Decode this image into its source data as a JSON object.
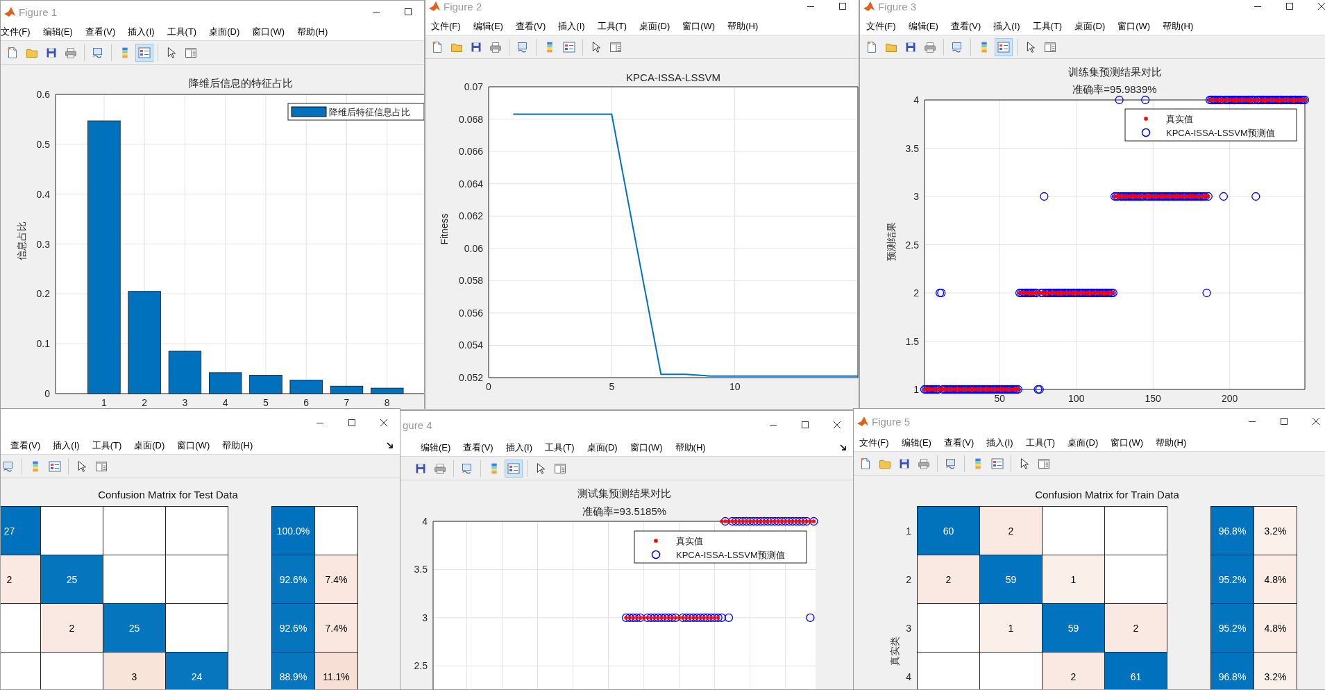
{
  "windows": [
    {
      "title": "Figure 1",
      "kind": "chart",
      "menu": [
        "文件(F)",
        "编辑(E)",
        "查看(V)",
        "插入(I)",
        "工具(T)",
        "桌面(D)",
        "窗口(W)",
        "帮助(H)"
      ],
      "legend_tool_on": true,
      "chart_data": {
        "type": "bar",
        "title": "降维后信息的特征占比",
        "ylabel": "信息占比",
        "categories": [
          "1",
          "2",
          "3",
          "4",
          "5",
          "6",
          "7",
          "8"
        ],
        "ylim": [
          0,
          0.6
        ],
        "yticks": [
          0,
          0.1,
          0.2,
          0.3,
          0.4,
          0.5,
          0.6
        ],
        "grid": true,
        "legend": true,
        "series": [
          {
            "name": "降维后特征信息占比",
            "color": "#0072bd",
            "values": [
              0.547,
              0.205,
              0.085,
              0.042,
              0.037,
              0.027,
              0.015,
              0.011
            ]
          }
        ]
      }
    },
    {
      "title": "Figure 2",
      "kind": "chart",
      "menu": [
        "文件(F)",
        "编辑(E)",
        "查看(V)",
        "插入(I)",
        "工具(T)",
        "桌面(D)",
        "窗口(W)",
        "帮助(H)"
      ],
      "legend_tool_on": false,
      "chart_data": {
        "type": "line",
        "title": "KPCA-ISSA-LSSVM",
        "ylabel": "Fitness",
        "x": [
          1,
          2,
          3,
          4,
          5,
          6,
          7,
          8,
          9,
          10,
          11,
          12,
          13,
          14,
          15
        ],
        "xlim": [
          0,
          15
        ],
        "ylim": [
          0.052,
          0.07
        ],
        "xticks": [
          0,
          5,
          10
        ],
        "yticks": [
          0.052,
          0.054,
          0.056,
          0.058,
          0.06,
          0.062,
          0.064,
          0.066,
          0.068,
          0.07
        ],
        "grid": true,
        "series": [
          {
            "color": "#0072bd",
            "values": [
              0.0683,
              0.0683,
              0.0683,
              0.0683,
              0.0683,
              0.0602,
              0.0522,
              0.0522,
              0.0521,
              0.0521,
              0.0521,
              0.0521,
              0.0521,
              0.0521,
              0.0521
            ]
          }
        ]
      }
    },
    {
      "title": "Figure 3",
      "kind": "chart",
      "menu": [
        "文件(F)",
        "编辑(E)",
        "查看(V)",
        "插入(I)",
        "工具(T)",
        "桌面(D)",
        "窗口(W)",
        "帮助(H)"
      ],
      "legend_tool_on": true,
      "chart_data": {
        "type": "scatter",
        "title": "训练集预测结果对比",
        "subtitle": "准确率=95.9839%",
        "ylabel": "预测结果",
        "x": [
          1,
          2,
          3,
          4,
          5,
          6,
          7,
          8,
          9,
          10,
          11,
          12,
          13,
          14,
          15,
          16,
          17,
          18,
          19,
          20,
          21,
          22,
          23,
          24,
          25,
          26,
          27,
          28,
          29,
          30,
          31,
          32,
          33,
          34,
          35,
          36,
          37,
          38,
          39,
          40,
          41,
          42,
          43,
          44,
          45,
          46,
          47,
          48,
          49,
          50,
          51,
          52,
          53,
          54,
          55,
          56,
          57,
          58,
          59,
          60,
          61,
          62,
          63,
          64,
          65,
          66,
          67,
          68,
          69,
          70,
          71,
          72,
          73,
          74,
          75,
          76,
          77,
          78,
          79,
          80,
          81,
          82,
          83,
          84,
          85,
          86,
          87,
          88,
          89,
          90,
          91,
          92,
          93,
          94,
          95,
          96,
          97,
          98,
          99,
          100,
          101,
          102,
          103,
          104,
          105,
          106,
          107,
          108,
          109,
          110,
          111,
          112,
          113,
          114,
          115,
          116,
          117,
          118,
          119,
          120,
          121,
          122,
          123,
          124,
          125,
          126,
          127,
          128,
          129,
          130,
          131,
          132,
          133,
          134,
          135,
          136,
          137,
          138,
          139,
          140,
          141,
          142,
          143,
          144,
          145,
          146,
          147,
          148,
          149,
          150,
          151,
          152,
          153,
          154,
          155,
          156,
          157,
          158,
          159,
          160,
          161,
          162,
          163,
          164,
          165,
          166,
          167,
          168,
          169,
          170,
          171,
          172,
          173,
          174,
          175,
          176,
          177,
          178,
          179,
          180,
          181,
          182,
          183,
          184,
          185,
          186,
          187,
          188,
          189,
          190,
          191,
          192,
          193,
          194,
          195,
          196,
          197,
          198,
          199,
          200,
          201,
          202,
          203,
          204,
          205,
          206,
          207,
          208,
          209,
          210,
          211,
          212,
          213,
          214,
          215,
          216,
          217,
          218,
          219,
          220,
          221,
          222,
          223,
          224,
          225,
          226,
          227,
          228,
          229,
          230,
          231,
          232,
          233,
          234,
          235,
          236,
          237,
          238,
          239,
          240,
          241,
          242,
          243,
          244,
          245,
          246,
          247,
          248,
          249
        ],
        "xlim": [
          1,
          249
        ],
        "ylim": [
          1,
          4
        ],
        "xticks": [
          50,
          100,
          150,
          200
        ],
        "yticks": [
          1,
          1.5,
          2,
          2.5,
          3,
          3.5,
          4
        ],
        "grid": true,
        "legend": true,
        "series": [
          {
            "name": "真实值",
            "color": "#ff0000",
            "marker": "cross",
            "values": [
              1,
              1,
              1,
              1,
              1,
              1,
              1,
              1,
              1,
              1,
              1,
              1,
              1,
              1,
              1,
              1,
              1,
              1,
              1,
              1,
              1,
              1,
              1,
              1,
              1,
              1,
              1,
              1,
              1,
              1,
              1,
              1,
              1,
              1,
              1,
              1,
              1,
              1,
              1,
              1,
              1,
              1,
              1,
              1,
              1,
              1,
              1,
              1,
              1,
              1,
              1,
              1,
              1,
              1,
              1,
              1,
              1,
              1,
              1,
              1,
              1,
              1,
              2,
              2,
              2,
              2,
              2,
              2,
              2,
              2,
              2,
              2,
              2,
              2,
              2,
              2,
              2,
              2,
              2,
              2,
              2,
              2,
              2,
              2,
              2,
              2,
              2,
              2,
              2,
              2,
              2,
              2,
              2,
              2,
              2,
              2,
              2,
              2,
              2,
              2,
              2,
              2,
              2,
              2,
              2,
              2,
              2,
              2,
              2,
              2,
              2,
              2,
              2,
              2,
              2,
              2,
              2,
              2,
              2,
              2,
              2,
              2,
              2,
              2,
              3,
              3,
              3,
              3,
              3,
              3,
              3,
              3,
              3,
              3,
              3,
              3,
              3,
              3,
              3,
              3,
              3,
              3,
              3,
              3,
              3,
              3,
              3,
              3,
              3,
              3,
              3,
              3,
              3,
              3,
              3,
              3,
              3,
              3,
              3,
              3,
              3,
              3,
              3,
              3,
              3,
              3,
              3,
              3,
              3,
              3,
              3,
              3,
              3,
              3,
              3,
              3,
              3,
              3,
              3,
              3,
              3,
              3,
              3,
              3,
              3,
              3,
              4,
              4,
              4,
              4,
              4,
              4,
              4,
              4,
              4,
              4,
              4,
              4,
              4,
              4,
              4,
              4,
              4,
              4,
              4,
              4,
              4,
              4,
              4,
              4,
              4,
              4,
              4,
              4,
              4,
              4,
              4,
              4,
              4,
              4,
              4,
              4,
              4,
              4,
              4,
              4,
              4,
              4,
              4,
              4,
              4,
              4,
              4,
              4,
              4,
              4,
              4,
              4,
              4,
              4,
              4,
              4,
              4,
              4,
              4,
              4,
              4,
              4,
              4
            ]
          },
          {
            "name": "KPCA-ISSA-LSSVM预测值",
            "color": "#0000ff",
            "marker": "circle",
            "values": [
              1,
              1,
              1,
              1,
              1,
              1,
              1,
              1,
              1,
              1,
              2,
              2,
              1,
              1,
              1,
              1,
              1,
              1,
              1,
              1,
              1,
              1,
              1,
              1,
              1,
              1,
              1,
              1,
              1,
              1,
              1,
              1,
              1,
              1,
              1,
              1,
              1,
              1,
              1,
              1,
              1,
              1,
              1,
              1,
              1,
              1,
              1,
              1,
              1,
              1,
              1,
              1,
              1,
              1,
              1,
              1,
              1,
              1,
              1,
              1,
              1,
              1,
              2,
              2,
              2,
              2,
              2,
              2,
              2,
              2,
              2,
              2,
              2,
              2,
              1,
              1,
              2,
              2,
              3,
              2,
              2,
              2,
              2,
              2,
              2,
              2,
              2,
              2,
              2,
              2,
              2,
              2,
              2,
              2,
              2,
              2,
              2,
              2,
              2,
              2,
              2,
              2,
              2,
              2,
              2,
              2,
              2,
              2,
              2,
              2,
              2,
              2,
              2,
              2,
              2,
              2,
              2,
              2,
              2,
              2,
              2,
              2,
              2,
              2,
              3,
              3,
              3,
              4,
              3,
              3,
              3,
              3,
              3,
              3,
              3,
              3,
              3,
              3,
              3,
              3,
              3,
              3,
              3,
              3,
              4,
              3,
              3,
              3,
              3,
              3,
              3,
              3,
              3,
              3,
              3,
              3,
              3,
              3,
              3,
              3,
              3,
              3,
              3,
              3,
              3,
              3,
              3,
              3,
              3,
              3,
              3,
              3,
              3,
              3,
              3,
              3,
              3,
              3,
              3,
              3,
              3,
              3,
              3,
              3,
              2,
              3,
              4,
              4,
              4,
              4,
              4,
              4,
              4,
              4,
              4,
              3,
              4,
              4,
              4,
              4,
              4,
              4,
              4,
              4,
              4,
              4,
              4,
              4,
              4,
              4,
              4,
              4,
              4,
              4,
              4,
              4,
              3,
              4,
              4,
              4,
              4,
              4,
              4,
              4,
              4,
              4,
              4,
              4,
              4,
              4,
              4,
              4,
              4,
              4,
              4,
              4,
              4,
              4,
              4,
              4,
              4,
              4,
              4,
              4,
              4,
              4,
              4,
              4,
              4
            ]
          }
        ]
      }
    },
    {
      "kind": "matrix",
      "menu": [
        "查看(V)",
        "插入(I)",
        "工具(T)",
        "桌面(D)",
        "窗口(W)",
        "帮助(H)"
      ],
      "legend_tool_on": false,
      "chart_title": "Confusion Matrix for Test Data",
      "cells": [
        [
          "27",
          null,
          null,
          null
        ],
        [
          "2",
          "25",
          null,
          null
        ],
        [
          null,
          "2",
          "25",
          null
        ],
        [
          null,
          null,
          "3",
          "24"
        ]
      ],
      "summary": [
        [
          "100.0%"
        ],
        [
          "92.6%",
          "7.4%"
        ],
        [
          "92.6%",
          "7.4%"
        ],
        [
          "88.9%",
          "11.1%"
        ]
      ]
    },
    {
      "title": "gure 4",
      "kind": "chart",
      "menu": [
        "编辑(E)",
        "查看(V)",
        "插入(I)",
        "工具(T)",
        "桌面(D)",
        "窗口(W)",
        "帮助(H)"
      ],
      "legend_tool_on": true,
      "chart_data": {
        "type": "scatter",
        "title": "测试集预测结果对比",
        "subtitle": "准确率=93.5185%",
        "categories": [
          null,
          null,
          null,
          null,
          null,
          null,
          null,
          null,
          null,
          null,
          null,
          null,
          null,
          null,
          null,
          null,
          null,
          null,
          null,
          null,
          null,
          null,
          null,
          null,
          null,
          null,
          null,
          null,
          null,
          null,
          null,
          null,
          null,
          null,
          null,
          null,
          null,
          null,
          null,
          null,
          null,
          null,
          null,
          null,
          null,
          null,
          null,
          null,
          null,
          null,
          null,
          null,
          null,
          null,
          null,
          null,
          null,
          null,
          null,
          null,
          null,
          null,
          null,
          null,
          null,
          null,
          null,
          null,
          null,
          null,
          null,
          null,
          null,
          null,
          null,
          null,
          null,
          null,
          null,
          null,
          null,
          null,
          null,
          null,
          null,
          null,
          null,
          null,
          null,
          null,
          null,
          null,
          null,
          null,
          null,
          null,
          null,
          null,
          null,
          null,
          null,
          null,
          null,
          null,
          null,
          null,
          null,
          null
        ],
        "ylim": [
          2.25,
          4
        ],
        "yticks": [
          2.5,
          3,
          3.5,
          4
        ],
        "grid": true,
        "legend": true,
        "series": [
          {
            "name": "真实值",
            "color": "#ff0000",
            "marker": "cross",
            "values": [
              null,
              null,
              null,
              null,
              null,
              null,
              null,
              null,
              null,
              null,
              null,
              null,
              null,
              null,
              null,
              null,
              null,
              null,
              null,
              null,
              null,
              null,
              null,
              null,
              null,
              null,
              null,
              null,
              null,
              null,
              null,
              null,
              null,
              null,
              null,
              null,
              null,
              null,
              null,
              null,
              null,
              null,
              null,
              null,
              null,
              null,
              null,
              null,
              null,
              null,
              null,
              null,
              null,
              null,
              3,
              3,
              3,
              3,
              3,
              3,
              3,
              3,
              3,
              3,
              3,
              3,
              3,
              3,
              3,
              3,
              3,
              3,
              3,
              3,
              3,
              3,
              3,
              3,
              3,
              3,
              3,
              4,
              4,
              4,
              4,
              4,
              4,
              4,
              4,
              4,
              4,
              4,
              4,
              4,
              4,
              4,
              4,
              4,
              4,
              4,
              4,
              4,
              4,
              4,
              4,
              4,
              4,
              4
            ]
          },
          {
            "name": "KPCA-ISSA-LSSVM预测值",
            "color": "#0000ff",
            "marker": "circle",
            "values": [
              null,
              null,
              null,
              null,
              null,
              null,
              null,
              null,
              null,
              null,
              null,
              null,
              null,
              null,
              null,
              null,
              null,
              null,
              null,
              null,
              null,
              null,
              null,
              null,
              null,
              null,
              null,
              null,
              null,
              null,
              null,
              null,
              null,
              null,
              null,
              null,
              null,
              null,
              null,
              null,
              null,
              null,
              null,
              null,
              null,
              null,
              null,
              null,
              null,
              null,
              null,
              null,
              null,
              null,
              3,
              3,
              3,
              3,
              3,
              null,
              3,
              3,
              3,
              3,
              3,
              3,
              3,
              3,
              3,
              null,
              3,
              3,
              3,
              3,
              3,
              3,
              3,
              3,
              3,
              3,
              3,
              3,
              4,
              3,
              4,
              4,
              4,
              4,
              4,
              4,
              4,
              4,
              4,
              4,
              4,
              4,
              4,
              4,
              4,
              4,
              4,
              4,
              4,
              4,
              4,
              4,
              3,
              4
            ]
          }
        ]
      }
    },
    {
      "title": "Figure 5",
      "kind": "matrix",
      "menu": [
        "文件(F)",
        "编辑(E)",
        "查看(V)",
        "插入(I)",
        "工具(T)",
        "桌面(D)",
        "窗口(W)",
        "帮助(H)"
      ],
      "legend_tool_on": false,
      "chart_title": "Confusion Matrix for Train Data",
      "ylabel": "真实类",
      "row_labels": [
        "1",
        "2",
        "3",
        "4"
      ],
      "cells": [
        [
          "60",
          "2",
          null,
          null
        ],
        [
          "2",
          "59",
          "1",
          null
        ],
        [
          null,
          "1",
          "59",
          "2"
        ],
        [
          null,
          null,
          "2",
          "61"
        ]
      ],
      "summary": [
        [
          "96.8%",
          "3.2%"
        ],
        [
          "95.2%",
          "4.8%"
        ],
        [
          "95.2%",
          "4.8%"
        ],
        [
          "96.8%",
          "3.2%"
        ]
      ]
    }
  ]
}
